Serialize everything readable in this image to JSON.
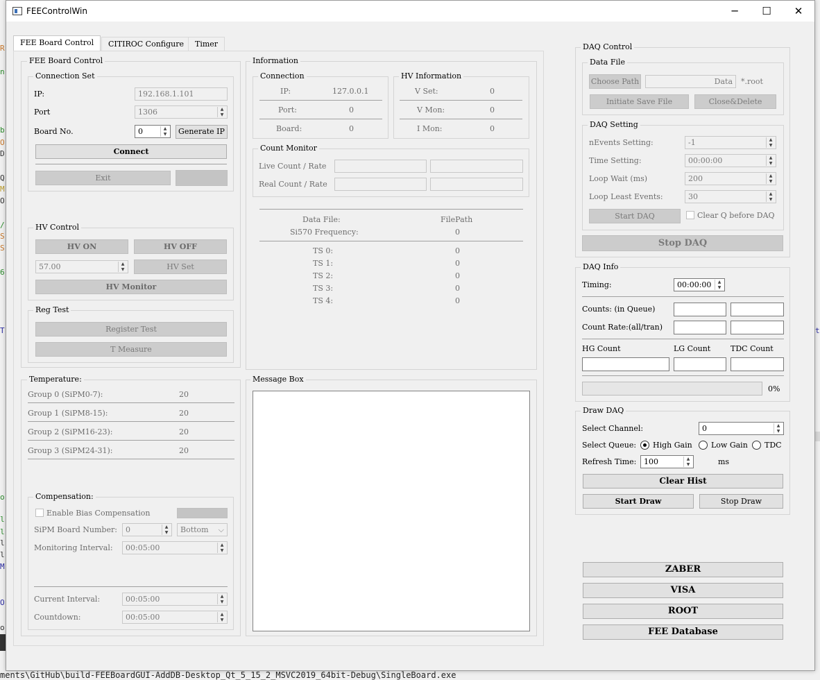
{
  "window": {
    "title": "FEEControlWin",
    "min_label": "─",
    "max_label": "☐",
    "close_label": "✕"
  },
  "background": {
    "bottom_path": "ments\\GitHub\\build-FEEBoardGUI-AddDB-Desktop_Qt_5_15_2_MSVC2019_64bit-Debug\\SingleBoard.exe",
    "left_chars": [
      "R",
      "n",
      "b",
      "O",
      "D",
      "Q",
      "M",
      "O",
      "/",
      "S",
      "S",
      "6",
      "T",
      "o",
      "l",
      "l",
      "l",
      "l",
      "M",
      "O",
      "o"
    ],
    "right_chars": [
      "t"
    ]
  },
  "tabs": [
    "FEE Board Control",
    "CITIROC Configure",
    "Timer"
  ],
  "fee_board": {
    "title": "FEE Board Control",
    "connection_set": {
      "title": "Connection Set",
      "ip_label": "IP:",
      "ip_value": "192.168.1.101",
      "port_label": "Port",
      "port_value": "1306",
      "board_label": "Board No.",
      "board_value": "0",
      "generate_ip": "Generate IP",
      "connect": "Connect",
      "exit": "Exit"
    },
    "hv_control": {
      "title": "HV Control",
      "hv_on": "HV ON",
      "hv_off": "HV OFF",
      "hv_value": "57.00",
      "hv_set": "HV Set",
      "hv_monitor": "HV Monitor"
    },
    "reg_test": {
      "title": "Reg Test",
      "register_test": "Register Test",
      "t_measure": "T Measure"
    }
  },
  "information": {
    "title": "Information",
    "connection": {
      "title": "Connection",
      "rows": [
        {
          "label": "IP:",
          "value": "127.0.0.1"
        },
        {
          "label": "Port:",
          "value": "0"
        },
        {
          "label": "Board:",
          "value": "0"
        }
      ]
    },
    "hv_info": {
      "title": "HV Information",
      "rows": [
        {
          "label": "V Set:",
          "value": "0"
        },
        {
          "label": "V Mon:",
          "value": "0"
        },
        {
          "label": "I Mon:",
          "value": "0"
        }
      ]
    },
    "count_monitor": {
      "title": "Count Monitor",
      "live_label": "Live Count / Rate",
      "real_label": "Real Count / Rate"
    },
    "data_file_label": "Data File:",
    "data_file_value": "FilePath",
    "si570_label": "Si570 Frequency:",
    "si570_value": "0",
    "ts": [
      {
        "label": "TS 0:",
        "value": "0"
      },
      {
        "label": "TS 1:",
        "value": "0"
      },
      {
        "label": "TS 2:",
        "value": "0"
      },
      {
        "label": "TS 3:",
        "value": "0"
      },
      {
        "label": "TS 4:",
        "value": "0"
      }
    ]
  },
  "temperature": {
    "title": "Temperature:",
    "rows": [
      {
        "label": "Group 0 (SiPM0-7):",
        "value": "20"
      },
      {
        "label": "Group 1 (SiPM8-15):",
        "value": "20"
      },
      {
        "label": "Group 2 (SiPM16-23):",
        "value": "20"
      },
      {
        "label": "Group 3 (SiPM24-31):",
        "value": "20"
      }
    ],
    "compensation": {
      "title": "Compensation:",
      "enable_label": "Enable Bias Compensation",
      "board_number_label": "SiPM Board Number:",
      "board_number_value": "0",
      "board_side": "Bottom",
      "monitoring_label": "Monitoring Interval:",
      "monitoring_value": "00:05:00",
      "current_label": "Current Interval:",
      "current_value": "00:05:00",
      "countdown_label": "Countdown:",
      "countdown_value": "00:05:00"
    }
  },
  "message_box": {
    "title": "Message Box"
  },
  "daq_control": {
    "title": "DAQ Control",
    "data_file": {
      "title": "Data File",
      "choose_path": "Choose Path",
      "file_value": "Data",
      "suffix": "*.root",
      "initiate": "Initiate Save File",
      "close_delete": "Close&Delete"
    },
    "daq_setting": {
      "title": "DAQ Setting",
      "nevents_label": "nEvents Setting:",
      "nevents_value": "-1",
      "time_label": "Time Setting:",
      "time_value": "00:00:00",
      "loop_wait_label": "Loop Wait (ms)",
      "loop_wait_value": "200",
      "loop_least_label": "Loop Least Events:",
      "loop_least_value": "30",
      "start_daq": "Start DAQ",
      "clear_q": "Clear Q before DAQ"
    },
    "stop_daq": "Stop DAQ"
  },
  "daq_info": {
    "title": "DAQ Info",
    "timing_label": "Timing:",
    "timing_value": "00:00:00",
    "counts_label": "Counts: (in Queue)",
    "count_rate_label": "Count Rate:(all/tran)",
    "hg_label": "HG Count",
    "lg_label": "LG Count",
    "tdc_label": "TDC Count",
    "progress_percent": "0%",
    "progress_fraction": 0
  },
  "draw_daq": {
    "title": "Draw DAQ",
    "select_channel_label": "Select Channel:",
    "select_channel_value": "0",
    "select_queue_label": "Select Queue:",
    "queue_options": [
      "High Gain",
      "Low Gain",
      "TDC"
    ],
    "queue_selected": "High Gain",
    "refresh_label": "Refresh Time:",
    "refresh_value": "100",
    "refresh_unit": "ms",
    "clear_hist": "Clear Hist",
    "start_draw": "Start Draw",
    "stop_draw": "Stop Draw"
  },
  "tools": [
    "ZABER",
    "VISA",
    "ROOT",
    "FEE Database"
  ]
}
